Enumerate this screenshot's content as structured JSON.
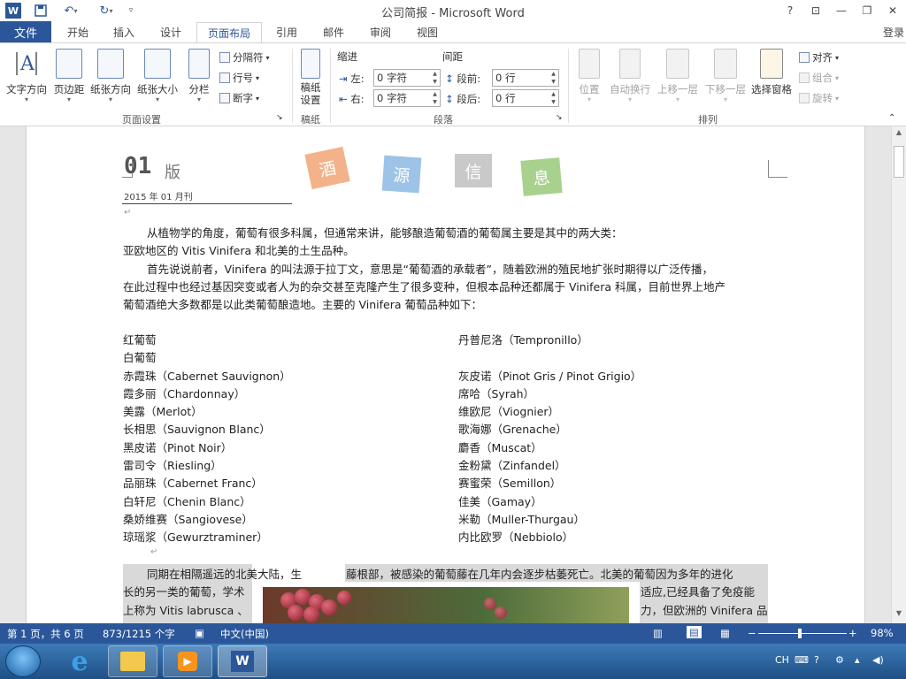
{
  "titlebar": {
    "title": "公司简报 - Microsoft Word",
    "help": "?",
    "restore_ribbon": "⊡",
    "minimize": "—",
    "maximize": "❐",
    "close": "✕",
    "qa_icons": [
      "word-app-icon",
      "save-icon",
      "undo-icon",
      "redo-icon",
      "customize-icon"
    ]
  },
  "tabs": {
    "file": "文件",
    "items": [
      "开始",
      "插入",
      "设计",
      "页面布局",
      "引用",
      "邮件",
      "审阅",
      "视图"
    ],
    "active": "页面布局",
    "login": "登录"
  },
  "ribbon": {
    "page_setup": {
      "label": "页面设置",
      "text_direction": "文字方向",
      "margins": "页边距",
      "orientation": "纸张方向",
      "size": "纸张大小",
      "columns": "分栏",
      "breaks": "分隔符",
      "line_numbers": "行号",
      "hyphenation": "断字"
    },
    "draft": {
      "label": "稿纸",
      "setup": "稿纸\n设置",
      "setup_line1": "稿纸",
      "setup_line2": "设置"
    },
    "paragraph": {
      "label": "段落",
      "indent": "缩进",
      "spacing": "间距",
      "left_label": "左:",
      "left_value": "0 字符",
      "right_label": "右:",
      "right_value": "0 字符",
      "before_label": "段前:",
      "before_value": "0 行",
      "after_label": "段后:",
      "after_value": "0 行"
    },
    "arrange": {
      "label": "排列",
      "position": "位置",
      "wrap": "自动换行",
      "bring_forward": "上移一层",
      "send_backward": "下移一层",
      "selection_pane": "选择窗格",
      "align": "对齐",
      "group": "组合",
      "rotate": "旋转"
    }
  },
  "document": {
    "issue": "01",
    "issue_suffix": "版",
    "tags": [
      "酒",
      "源",
      "信",
      "息"
    ],
    "tag_colors": [
      "#f4b28a",
      "#9dc3e6",
      "#c9c9c9",
      "#a9d18e"
    ],
    "date": "2015 年 01 月刊",
    "para1_line1": "从植物学的角度，葡萄有很多科属，但通常来讲，能够酿造葡萄酒的葡萄属主要是其中的两大类：",
    "para1_line2": "亚欧地区的 Vitis Vinifera 和北美的土生品种。",
    "para2_line1": "首先说说前者，Vinifera 的叫法源于拉丁文，意思是“葡萄酒的承载者”，随着欧洲的殖民地扩张时期得以广泛传播，",
    "para2_line2": "在此过程中也经过基因突变或者人为的杂交甚至克隆产生了很多变种，但根本品种还都属于 Vinifera 科属，目前世界上地产",
    "para2_line3": "葡萄酒绝大多数都是以此类葡萄酿造地。主要的 Vinifera 葡萄品种如下：",
    "col_left": [
      "红葡萄",
      "白葡萄",
      "赤霞珠（Cabernet Sauvignon）",
      "霞多丽（Chardonnay）",
      "美露（Merlot）",
      "长相思（Sauvignon Blanc）",
      "黑皮诺（Pinot Noir）",
      "雷司令（Riesling）",
      "品丽珠（Cabernet Franc）",
      "白轩尼（Chenin Blanc）",
      "桑娇维赛（Sangiovese）",
      "琼瑶浆（Gewurztraminer）"
    ],
    "col_right": [
      "丹普尼洛（Tempronillo）",
      "",
      "灰皮诺（Pinot Gris / Pinot Grigio）",
      "席哈（Syrah）",
      "维欧尼（Viognier）",
      "歌海娜（Grenache）",
      "麝香（Muscat）",
      "金粉黛（Zinfandel）",
      "赛蜜荣（Semillon）",
      "佳美（Gamay）",
      "米勒（Muller-Thurgau）",
      "内比欧罗（Nebbiolo）"
    ],
    "bottom_left_1": "同期在相隔遥远的北美大陆，生",
    "bottom_left_2": "长的另一类的葡萄，学术",
    "bottom_left_3": "上称为  Vitis labrusca 、",
    "bottom_right_1": "藤根部，被感染的葡萄藤在几年内会逐步枯萎死亡。北美的葡萄因为多年的进化",
    "bottom_right_2": "适应,已经具备了免疫能",
    "bottom_right_3": "力，但欧洲的 Vinifera 品"
  },
  "statusbar": {
    "page": "第 1 页，共 6 页",
    "words": "873/1215 个字",
    "language": "中文(中国)",
    "zoom": "98%",
    "zoom_minus": "−",
    "zoom_plus": "+"
  },
  "taskbar": {
    "items": [
      "start-orb",
      "internet-explorer",
      "file-explorer",
      "media-player",
      "microsoft-word"
    ],
    "tray_lang": "CH"
  }
}
